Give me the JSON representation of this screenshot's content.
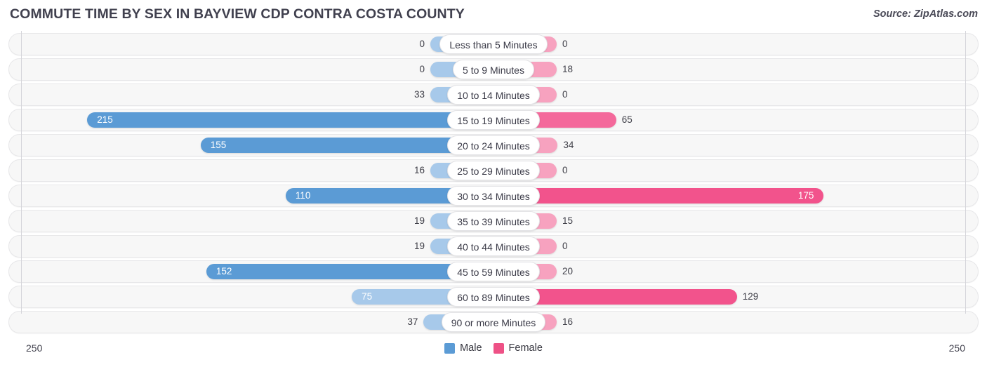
{
  "header": {
    "title": "COMMUTE TIME BY SEX IN BAYVIEW CDP CONTRA COSTA COUNTY",
    "source": "Source: ZipAtlas.com"
  },
  "axis": {
    "left_max_label": "250",
    "right_max_label": "250",
    "max": 250
  },
  "legend": {
    "items": [
      {
        "label": "Male",
        "color": "#5b9bd5"
      },
      {
        "label": "Female",
        "color": "#ee5186"
      }
    ]
  },
  "colors": {
    "male_strong": "#5b9bd5",
    "male_light": "#a7c9ea",
    "female_strong": "#f2538c",
    "female_mid": "#f4699b",
    "female_light": "#f7a2bf",
    "track_bg": "#f7f7f7",
    "track_border": "#e7e7e9",
    "axis_line": "#d5d5da",
    "title": "#41414f"
  },
  "chart_data": {
    "type": "bar",
    "orientation": "horizontal",
    "style": "diverging-bidirectional",
    "title": "COMMUTE TIME BY SEX IN BAYVIEW CDP CONTRA COSTA COUNTY",
    "subtitle": "",
    "xlabel": "",
    "ylabel": "",
    "xlim": [
      250,
      250
    ],
    "axis_max": 250,
    "grid": false,
    "legend_position": "bottom-center",
    "categories": [
      "Less than 5 Minutes",
      "5 to 9 Minutes",
      "10 to 14 Minutes",
      "15 to 19 Minutes",
      "20 to 24 Minutes",
      "25 to 29 Minutes",
      "30 to 34 Minutes",
      "35 to 39 Minutes",
      "40 to 44 Minutes",
      "45 to 59 Minutes",
      "60 to 89 Minutes",
      "90 or more Minutes"
    ],
    "series": [
      {
        "name": "Male",
        "side": "left",
        "values": [
          0,
          0,
          33,
          215,
          155,
          16,
          110,
          19,
          19,
          152,
          75,
          37
        ]
      },
      {
        "name": "Female",
        "side": "right",
        "values": [
          0,
          18,
          0,
          65,
          34,
          0,
          175,
          15,
          0,
          20,
          129,
          16
        ]
      }
    ]
  },
  "rows": [
    {
      "label": "Less than 5 Minutes",
      "male": 0,
      "male_text": "0",
      "female": 0,
      "female_text": "0"
    },
    {
      "label": "5 to 9 Minutes",
      "male": 0,
      "male_text": "0",
      "female": 18,
      "female_text": "18"
    },
    {
      "label": "10 to 14 Minutes",
      "male": 33,
      "male_text": "33",
      "female": 0,
      "female_text": "0"
    },
    {
      "label": "15 to 19 Minutes",
      "male": 215,
      "male_text": "215",
      "female": 65,
      "female_text": "65"
    },
    {
      "label": "20 to 24 Minutes",
      "male": 155,
      "male_text": "155",
      "female": 34,
      "female_text": "34"
    },
    {
      "label": "25 to 29 Minutes",
      "male": 16,
      "male_text": "16",
      "female": 0,
      "female_text": "0"
    },
    {
      "label": "30 to 34 Minutes",
      "male": 110,
      "male_text": "110",
      "female": 175,
      "female_text": "175"
    },
    {
      "label": "35 to 39 Minutes",
      "male": 19,
      "male_text": "19",
      "female": 15,
      "female_text": "15"
    },
    {
      "label": "40 to 44 Minutes",
      "male": 19,
      "male_text": "19",
      "female": 0,
      "female_text": "0"
    },
    {
      "label": "45 to 59 Minutes",
      "male": 152,
      "male_text": "152",
      "female": 20,
      "female_text": "20"
    },
    {
      "label": "60 to 89 Minutes",
      "male": 75,
      "male_text": "75",
      "female": 129,
      "female_text": "129"
    },
    {
      "label": "90 or more Minutes",
      "male": 37,
      "male_text": "37",
      "female": 16,
      "female_text": "16"
    }
  ]
}
